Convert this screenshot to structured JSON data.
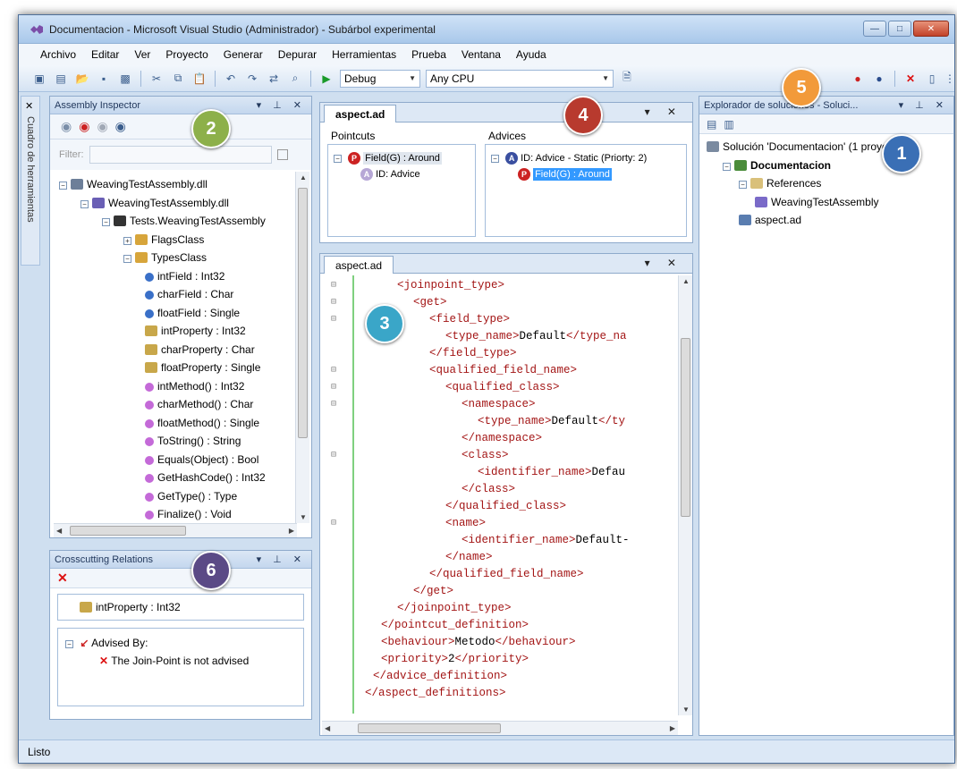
{
  "window": {
    "title": "Documentacion - Microsoft Visual Studio (Administrador) - Subárbol experimental",
    "buttons": [
      "—",
      "□",
      "✕"
    ]
  },
  "menu": [
    "Archivo",
    "Editar",
    "Ver",
    "Proyecto",
    "Generar",
    "Depurar",
    "Herramientas",
    "Prueba",
    "Ventana",
    "Ayuda"
  ],
  "toolbar": {
    "config": "Debug",
    "platform": "Any CPU"
  },
  "side_tab": "Cuadro de herramientas",
  "assembly_inspector": {
    "title": "Assembly Inspector",
    "filter_label": "Filter:",
    "tree": [
      {
        "label": "WeavingTestAssembly.dll",
        "indent": 0,
        "icon": "assembly-icon"
      },
      {
        "label": "WeavingTestAssembly.dll",
        "indent": 1,
        "icon": "module-icon"
      },
      {
        "label": "Tests.WeavingTestAssembly",
        "indent": 2,
        "icon": "namespace-icon"
      },
      {
        "label": "FlagsClass",
        "indent": 3,
        "icon": "class-icon"
      },
      {
        "label": "TypesClass",
        "indent": 3,
        "icon": "class-icon"
      },
      {
        "label": "intField : Int32",
        "indent": 4,
        "icon": "field-icon"
      },
      {
        "label": "charField : Char",
        "indent": 4,
        "icon": "field-icon"
      },
      {
        "label": "floatField : Single",
        "indent": 4,
        "icon": "field-icon"
      },
      {
        "label": "intProperty : Int32",
        "indent": 4,
        "icon": "property-icon"
      },
      {
        "label": "charProperty : Char",
        "indent": 4,
        "icon": "property-icon"
      },
      {
        "label": "floatProperty : Single",
        "indent": 4,
        "icon": "property-icon"
      },
      {
        "label": "intMethod() : Int32",
        "indent": 4,
        "icon": "method-icon"
      },
      {
        "label": "charMethod() : Char",
        "indent": 4,
        "icon": "method-icon"
      },
      {
        "label": "floatMethod() : Single",
        "indent": 4,
        "icon": "method-icon"
      },
      {
        "label": "ToString() : String",
        "indent": 4,
        "icon": "method-icon"
      },
      {
        "label": "Equals(Object) : Bool",
        "indent": 4,
        "icon": "method-icon"
      },
      {
        "label": "GetHashCode() : Int32",
        "indent": 4,
        "icon": "method-icon"
      },
      {
        "label": "GetType() : Type",
        "indent": 4,
        "icon": "method-icon"
      },
      {
        "label": "Finalize() : Void",
        "indent": 4,
        "icon": "method-icon"
      }
    ]
  },
  "crosscutting": {
    "title": "Crosscutting Relations",
    "selected": "intProperty : Int32",
    "advised_by": "Advised By:",
    "not_advised": "The Join-Point is not advised"
  },
  "aspect_top": {
    "tab": "aspect.ad",
    "pointcuts_title": "Pointcuts",
    "advices_title": "Advices",
    "pointcut_item": "Field(G) : Around",
    "pointcut_child": "ID: Advice",
    "advice_item": "ID: Advice - Static (Priorty: 2)",
    "advice_child": "Field(G) : Around"
  },
  "aspect_editor": {
    "tab": "aspect.ad",
    "lines": [
      {
        "indent": 2,
        "parts": [
          [
            "tg",
            "<joinpoint_type>"
          ]
        ]
      },
      {
        "indent": 3,
        "parts": [
          [
            "tg",
            "<get>"
          ]
        ]
      },
      {
        "indent": 4,
        "parts": [
          [
            "tg",
            "<field_type>"
          ]
        ]
      },
      {
        "indent": 5,
        "parts": [
          [
            "tg",
            "<type_name>"
          ],
          [
            "tx",
            "Default"
          ],
          [
            "tg",
            "</type_na"
          ]
        ]
      },
      {
        "indent": 4,
        "parts": [
          [
            "tg",
            "</field_type>"
          ]
        ]
      },
      {
        "indent": 4,
        "parts": [
          [
            "tg",
            "<qualified_field_name>"
          ]
        ]
      },
      {
        "indent": 5,
        "parts": [
          [
            "tg",
            "<qualified_class>"
          ]
        ]
      },
      {
        "indent": 6,
        "parts": [
          [
            "tg",
            "<namespace>"
          ]
        ]
      },
      {
        "indent": 7,
        "parts": [
          [
            "tg",
            "<type_name>"
          ],
          [
            "tx",
            "Default"
          ],
          [
            "tg",
            "</ty"
          ]
        ]
      },
      {
        "indent": 6,
        "parts": [
          [
            "tg",
            "</namespace>"
          ]
        ]
      },
      {
        "indent": 6,
        "parts": [
          [
            "tg",
            "<class>"
          ]
        ]
      },
      {
        "indent": 7,
        "parts": [
          [
            "tg",
            "<identifier_name>"
          ],
          [
            "tx",
            "Defau"
          ]
        ]
      },
      {
        "indent": 6,
        "parts": [
          [
            "tg",
            "</class>"
          ]
        ]
      },
      {
        "indent": 5,
        "parts": [
          [
            "tg",
            "</qualified_class>"
          ]
        ]
      },
      {
        "indent": 5,
        "parts": [
          [
            "tg",
            "<name>"
          ]
        ]
      },
      {
        "indent": 6,
        "parts": [
          [
            "tg",
            "<identifier_name>"
          ],
          [
            "tx",
            "Default-"
          ]
        ]
      },
      {
        "indent": 5,
        "parts": [
          [
            "tg",
            "</name>"
          ]
        ]
      },
      {
        "indent": 4,
        "parts": [
          [
            "tg",
            "</qualified_field_name>"
          ]
        ]
      },
      {
        "indent": 3,
        "parts": [
          [
            "tg",
            "</get>"
          ]
        ]
      },
      {
        "indent": 2,
        "parts": [
          [
            "tg",
            "</joinpoint_type>"
          ]
        ]
      },
      {
        "indent": 1,
        "parts": [
          [
            "tg",
            "</pointcut_definition>"
          ]
        ]
      },
      {
        "indent": 1,
        "parts": [
          [
            "tg",
            "<behaviour>"
          ],
          [
            "tx",
            "Metodo"
          ],
          [
            "tg",
            "</behaviour>"
          ]
        ]
      },
      {
        "indent": 1,
        "parts": [
          [
            "tg",
            "<priority>"
          ],
          [
            "tx",
            "2"
          ],
          [
            "tg",
            "</priority>"
          ]
        ]
      },
      {
        "indent": 0.5,
        "parts": [
          [
            "tg",
            "</advice_definition>"
          ]
        ]
      },
      {
        "indent": 0,
        "parts": [
          [
            "tg",
            "</aspect_definitions>"
          ]
        ]
      }
    ]
  },
  "solution_explorer": {
    "title": "Explorador de soluciones - Soluci...",
    "items": [
      {
        "label": "Solución 'Documentacion' (1 proyecto)",
        "indent": 0,
        "bold": false,
        "icon": "solution-icon"
      },
      {
        "label": "Documentacion",
        "indent": 1,
        "bold": true,
        "icon": "project-icon"
      },
      {
        "label": "References",
        "indent": 2,
        "bold": false,
        "icon": "folder-icon"
      },
      {
        "label": "WeavingTestAssembly",
        "indent": 3,
        "bold": false,
        "icon": "reference-icon"
      },
      {
        "label": "aspect.ad",
        "indent": 2,
        "bold": false,
        "icon": "file-icon"
      }
    ]
  },
  "badges": [
    {
      "n": "1",
      "color": "#3a6fb5"
    },
    {
      "n": "2",
      "color": "#8db04a"
    },
    {
      "n": "3",
      "color": "#3aa6c8"
    },
    {
      "n": "4",
      "color": "#b83a2e"
    },
    {
      "n": "5",
      "color": "#f29a3a"
    },
    {
      "n": "6",
      "color": "#5b4a86"
    }
  ],
  "status": "Listo"
}
